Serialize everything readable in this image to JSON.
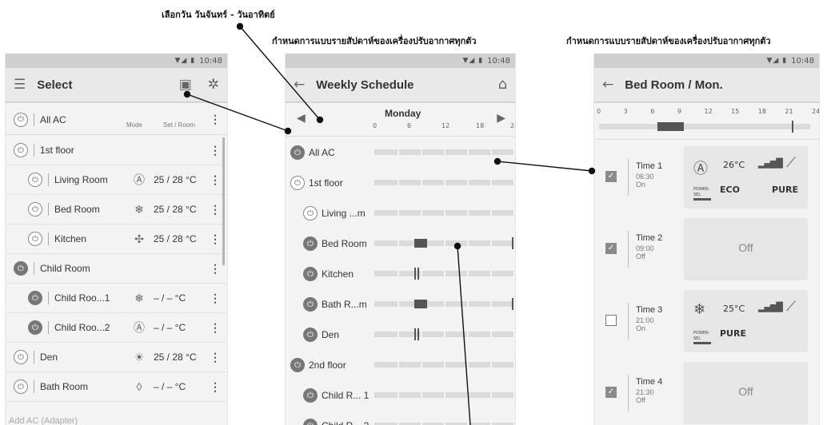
{
  "captions": {
    "select_day": "เลือกวัน วันจันทร์ - วันอาทิตย์",
    "weekly_setting_1": "กำหนดการแบบรายสัปดาห์ของเครื่องปรับอากาศทุกตัว",
    "weekly_setting_2": "กำหนดการแบบรายสัปดาห์ของเครื่องปรับอากาศทุกตัว"
  },
  "status": {
    "time": "10:48",
    "icons": "▼◢ ▮"
  },
  "select_screen": {
    "title": "Select",
    "menu_icon": "list-icon",
    "header": {
      "name": "All AC",
      "mode_col": "Mode",
      "set_col": "Set / Room"
    },
    "rows": [
      {
        "name": "1st floor",
        "indent": 0,
        "power": "off",
        "mode": "",
        "value": ""
      },
      {
        "name": "Living Room",
        "indent": 1,
        "power": "off",
        "mode": "Ⓐ",
        "value": "25 / 28 °C"
      },
      {
        "name": "Bed Room",
        "indent": 1,
        "power": "off",
        "mode": "❄",
        "value": "25 / 28 °C"
      },
      {
        "name": "Kitchen",
        "indent": 1,
        "power": "off",
        "mode": "✣",
        "value": "25 / 28 °C"
      },
      {
        "name": "Child Room",
        "indent": 0,
        "power": "on",
        "mode": "",
        "value": ""
      },
      {
        "name": "Child Roo...1",
        "indent": 1,
        "power": "on",
        "mode": "❄",
        "value": "– / –  °C"
      },
      {
        "name": "Child Roo...2",
        "indent": 1,
        "power": "on",
        "mode": "Ⓐ",
        "value": "– / –  °C"
      },
      {
        "name": "Den",
        "indent": 0,
        "power": "off",
        "mode": "☀",
        "value": "25 / 28 °C"
      },
      {
        "name": "Bath Room",
        "indent": 0,
        "power": "off",
        "mode": "◊",
        "value": "– / –  °C"
      }
    ],
    "footer": "Add AC (Adapter)"
  },
  "weekly_screen": {
    "title": "Weekly Schedule",
    "day": "Monday",
    "axis": [
      "0",
      "6",
      "12",
      "18",
      "24"
    ],
    "rows": [
      {
        "name": "All AC",
        "indent": 0,
        "power": "on"
      },
      {
        "name": "1st floor",
        "indent": 0,
        "power": "off"
      },
      {
        "name": "Living ...m",
        "indent": 1,
        "power": "off"
      },
      {
        "name": "Bed Room",
        "indent": 1,
        "power": "on"
      },
      {
        "name": "Kitchen",
        "indent": 1,
        "power": "on"
      },
      {
        "name": "Bath R...m",
        "indent": 1,
        "power": "on"
      },
      {
        "name": "Den",
        "indent": 1,
        "power": "on"
      },
      {
        "name": "2nd floor",
        "indent": 0,
        "power": "on"
      },
      {
        "name": "Child R... 1",
        "indent": 1,
        "power": "on"
      },
      {
        "name": "Child R... 2",
        "indent": 1,
        "power": "on"
      }
    ]
  },
  "detail_screen": {
    "title": "Bed Room / Mon.",
    "axis": [
      "0",
      "3",
      "6",
      "9",
      "12",
      "15",
      "18",
      "21",
      "24"
    ],
    "timers": [
      {
        "label": "Time 1",
        "time": "06:30",
        "state": "On",
        "checked": true,
        "pane": "mode",
        "mode_icon": "Ⓐ",
        "temp": "26°C",
        "signal": "▂▄▆█",
        "vane": "⟋",
        "powersel": "POWER-SEL",
        "eco": "ECO",
        "pure": "PURE"
      },
      {
        "label": "Time 2",
        "time": "09:00",
        "state": "Off",
        "checked": true,
        "pane": "off",
        "off_text": "Off"
      },
      {
        "label": "Time 3",
        "time": "21:00",
        "state": "On",
        "checked": false,
        "pane": "mode",
        "mode_icon": "❄",
        "temp": "25°C",
        "signal": "▂▄▆█",
        "vane": "⟋",
        "powersel": "POWER-SEL",
        "eco": "",
        "pure": "PURE"
      },
      {
        "label": "Time 4",
        "time": "21:30",
        "state": "Off",
        "checked": true,
        "pane": "off",
        "off_text": "Off"
      }
    ]
  }
}
